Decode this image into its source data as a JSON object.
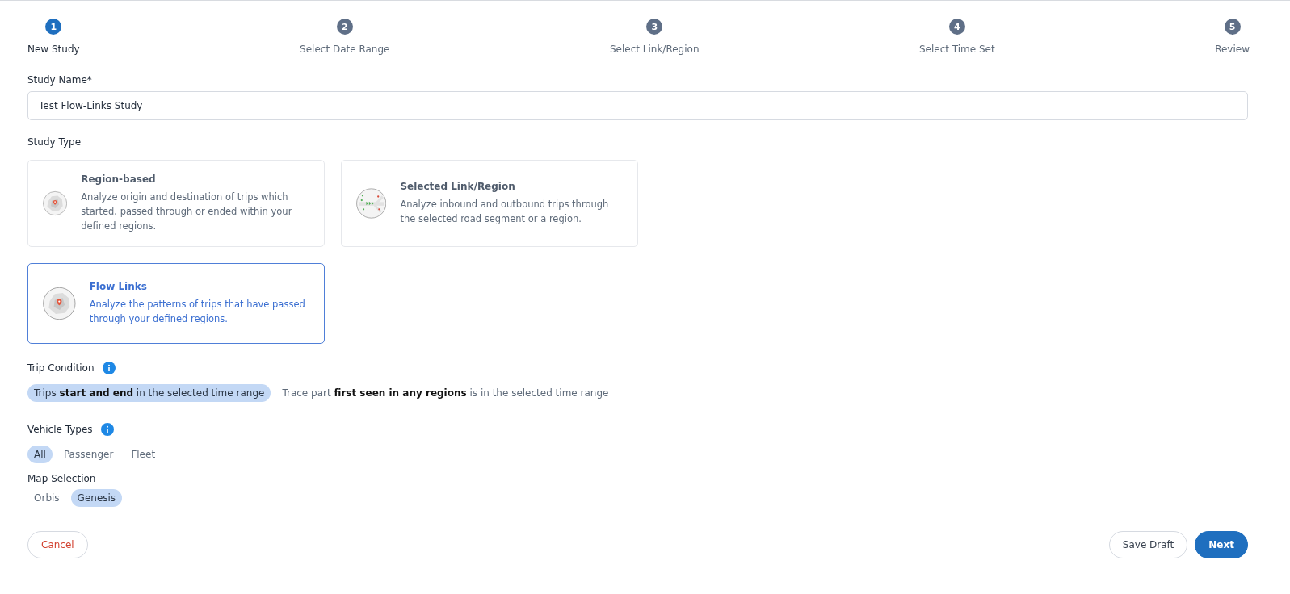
{
  "steps": [
    {
      "number": "1",
      "label": "New Study",
      "selected": true
    },
    {
      "number": "2",
      "label": "Select Date Range",
      "selected": false
    },
    {
      "number": "3",
      "label": "Select Link/Region",
      "selected": false
    },
    {
      "number": "4",
      "label": "Select Time Set",
      "selected": false
    },
    {
      "number": "5",
      "label": "Review",
      "selected": false
    }
  ],
  "study_name": {
    "label": "Study Name*",
    "value": "Test Flow-Links Study"
  },
  "study_type": {
    "label": "Study Type",
    "options": [
      {
        "kind": "region",
        "title": "Region-based",
        "description": "Analyze origin and destination of trips which started, passed through or ended within your defined regions.",
        "selected": false
      },
      {
        "kind": "link",
        "title": "Selected Link/Region",
        "description": "Analyze inbound and outbound trips through the selected road segment or a region.",
        "selected": false
      },
      {
        "kind": "region",
        "title": "Flow Links",
        "description": "Analyze the patterns of trips that have passed through your defined regions.",
        "selected": true
      }
    ]
  },
  "trip_condition": {
    "label": "Trip Condition",
    "options": [
      {
        "label": "Trips **start and end** in the selected time range",
        "selected": true
      },
      {
        "label": "Trace part **first seen in any regions** is in the selected time range",
        "selected": false
      }
    ]
  },
  "vehicle_types": {
    "label": "Vehicle Types",
    "options": [
      {
        "label": "All",
        "selected": true
      },
      {
        "label": "Passenger",
        "selected": false
      },
      {
        "label": "Fleet",
        "selected": false
      }
    ]
  },
  "map_selection": {
    "label": "Map Selection",
    "options": [
      {
        "label": "Orbis",
        "selected": false
      },
      {
        "label": "Genesis",
        "selected": true
      }
    ]
  },
  "buttons": {
    "cancel": "Cancel",
    "save_draft": "Save Draft",
    "next": "Next"
  }
}
